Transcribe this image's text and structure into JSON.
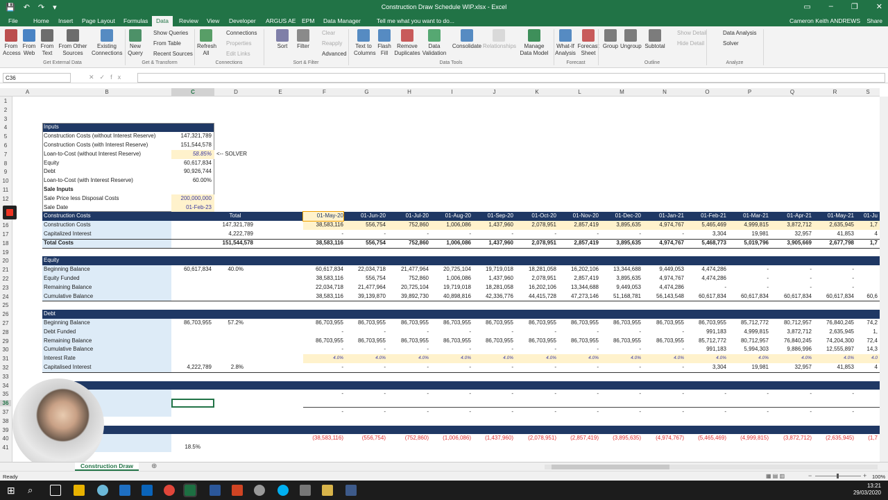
{
  "window": {
    "title": "Construction Draw Schedule WIP.xlsx - Excel",
    "user": "Cameron Keith ANDREWS",
    "share": "Share",
    "tell_me": "Tell me what you want to do..."
  },
  "tabs": [
    "File",
    "Home",
    "Insert",
    "Page Layout",
    "Formulas",
    "Data",
    "Review",
    "View",
    "Developer",
    "ARGUS AE",
    "EPM",
    "Data Manager"
  ],
  "ribbon": {
    "buttons": [
      "From Access",
      "From Web",
      "From Text",
      "From Other Sources",
      "Existing Connections",
      "New Query",
      "Refresh All",
      "Sort",
      "Filter",
      "Text to Columns",
      "Flash Fill",
      "Remove Duplicates",
      "Data Validation",
      "Consolidate",
      "Relationships",
      "Manage Data Model",
      "What-If Analysis",
      "Forecast Sheet",
      "Group",
      "Ungroup",
      "Subtotal"
    ],
    "small": [
      "Show Queries",
      "From Table",
      "Recent Sources",
      "Connections",
      "Properties",
      "Edit Links",
      "Clear",
      "Reapply",
      "Advanced",
      "Show Detail",
      "Hide Detail",
      "Data Analysis",
      "Solver"
    ],
    "groups": [
      "Get External Data",
      "Get & Transform",
      "Connections",
      "Sort & Filter",
      "Data Tools",
      "Forecast",
      "Outline",
      "Analyze"
    ]
  },
  "name_box": "C36",
  "columns": [
    "A",
    "B",
    "C",
    "D",
    "E",
    "F",
    "G",
    "H",
    "I",
    "J",
    "K",
    "L",
    "M",
    "N",
    "O",
    "P",
    "Q",
    "R",
    "S"
  ],
  "rows": [
    "1",
    "2",
    "3",
    "4",
    "5",
    "6",
    "7",
    "8",
    "9",
    "10",
    "11",
    "12",
    "",
    "15",
    "16",
    "17",
    "18",
    "19",
    "20",
    "21",
    "22",
    "23",
    "24",
    "25",
    "26",
    "27",
    "28",
    "29",
    "30",
    "31",
    "32",
    "33",
    "34",
    "35",
    "36",
    "37",
    "38",
    "39",
    "40",
    "41"
  ],
  "inputs": {
    "header": "Inputs",
    "rows": [
      {
        "label": "Construction Costs (without Interest Reserve)",
        "value": "147,321,789"
      },
      {
        "label": "Construction Costs (with Interest Reserve)",
        "value": "151,544,578"
      },
      {
        "label": "Loan-to-Cost (without Interest Reserve)",
        "value": "58.85%"
      },
      {
        "label": "Equity",
        "value": "60,617,834"
      },
      {
        "label": "Debt",
        "value": "90,926,744"
      },
      {
        "label": "Loan-to-Cost (with Interest Reserve)",
        "value": "60.00%"
      },
      {
        "label": "Sale Inputs",
        "value": ""
      },
      {
        "label": "Sale Price less Disposal Costs",
        "value": "200,000,000"
      },
      {
        "label": "Sale Date",
        "value": "01-Feb-23"
      }
    ],
    "solver_note": "<-- SOLVER"
  },
  "dates": [
    "01-May-20",
    "01-Jun-20",
    "01-Jul-20",
    "01-Aug-20",
    "01-Sep-20",
    "01-Oct-20",
    "01-Nov-20",
    "01-Dec-20",
    "01-Jan-21",
    "01-Feb-21",
    "01-Mar-21",
    "01-Apr-21",
    "01-May-21",
    "01-Ju"
  ],
  "costs": {
    "header": "Construction Costs",
    "total_label": "Total",
    "rows": [
      {
        "label": "Construction Costs",
        "total": "147,321,789",
        "vals": [
          "38,583,116",
          "556,754",
          "752,860",
          "1,006,086",
          "1,437,960",
          "2,078,951",
          "2,857,419",
          "3,895,635",
          "4,974,767",
          "5,465,469",
          "4,999,815",
          "3,872,712",
          "2,635,945",
          "1,7"
        ]
      },
      {
        "label": "Capitalized Interest",
        "total": "4,222,789",
        "vals": [
          "-",
          "-",
          "-",
          "-",
          "-",
          "-",
          "-",
          "-",
          "-",
          "3,304",
          "19,981",
          "32,957",
          "41,853",
          "4"
        ]
      },
      {
        "label": "Total Costs",
        "total": "151,544,578",
        "vals": [
          "38,583,116",
          "556,754",
          "752,860",
          "1,006,086",
          "1,437,960",
          "2,078,951",
          "2,857,419",
          "3,895,635",
          "4,974,767",
          "5,468,773",
          "5,019,796",
          "3,905,669",
          "2,677,798",
          "1,7"
        ]
      }
    ]
  },
  "equity": {
    "header": "Equity",
    "c": "60,617,834",
    "d": "40.0%",
    "rows": [
      {
        "label": "Beginning Balance",
        "vals": [
          "60,617,834",
          "22,034,718",
          "21,477,964",
          "20,725,104",
          "19,719,018",
          "18,281,058",
          "16,202,106",
          "13,344,688",
          "9,449,053",
          "4,474,286",
          "-",
          "-",
          "-",
          ""
        ]
      },
      {
        "label": "Equity Funded",
        "vals": [
          "38,583,116",
          "556,754",
          "752,860",
          "1,006,086",
          "1,437,960",
          "2,078,951",
          "2,857,419",
          "3,895,635",
          "4,974,767",
          "4,474,286",
          "-",
          "-",
          "-",
          ""
        ]
      },
      {
        "label": "Remaining Balance",
        "vals": [
          "22,034,718",
          "21,477,964",
          "20,725,104",
          "19,719,018",
          "18,281,058",
          "16,202,106",
          "13,344,688",
          "9,449,053",
          "4,474,286",
          "-",
          "-",
          "-",
          "-",
          ""
        ]
      },
      {
        "label": "Cumulative Balance",
        "vals": [
          "38,583,116",
          "39,139,870",
          "39,892,730",
          "40,898,816",
          "42,336,776",
          "44,415,728",
          "47,273,146",
          "51,168,781",
          "56,143,548",
          "60,617,834",
          "60,617,834",
          "60,617,834",
          "60,617,834",
          "60,6"
        ]
      }
    ]
  },
  "debt": {
    "header": "Debt",
    "c": "86,703,955",
    "d": "57.2%",
    "c32": "4,222,789",
    "d32": "2.8%",
    "rows": [
      {
        "label": "Beginning Balance",
        "vals": [
          "86,703,955",
          "86,703,955",
          "86,703,955",
          "86,703,955",
          "86,703,955",
          "86,703,955",
          "86,703,955",
          "86,703,955",
          "86,703,955",
          "86,703,955",
          "85,712,772",
          "80,712,957",
          "76,840,245",
          "74,2"
        ]
      },
      {
        "label": "Debt Funded",
        "vals": [
          "-",
          "-",
          "-",
          "-",
          "-",
          "-",
          "-",
          "-",
          "-",
          "991,183",
          "4,999,815",
          "3,872,712",
          "2,635,945",
          "1,"
        ]
      },
      {
        "label": "Remaining Balance",
        "vals": [
          "86,703,955",
          "86,703,955",
          "86,703,955",
          "86,703,955",
          "86,703,955",
          "86,703,955",
          "86,703,955",
          "86,703,955",
          "86,703,955",
          "85,712,772",
          "80,712,957",
          "76,840,245",
          "74,204,300",
          "72,4"
        ]
      },
      {
        "label": "Cumulative Balance",
        "vals": [
          "-",
          "-",
          "-",
          "-",
          "-",
          "-",
          "-",
          "-",
          "-",
          "991,183",
          "5,994,303",
          "9,886,996",
          "12,555,897",
          "14,3"
        ]
      },
      {
        "label": "Interest Rate",
        "vals": [
          "4.0%",
          "4.0%",
          "4.0%",
          "4.0%",
          "4.0%",
          "4.0%",
          "4.0%",
          "4.0%",
          "4.0%",
          "4.0%",
          "4.0%",
          "4.0%",
          "4.0%",
          "4.0"
        ]
      },
      {
        "label": "Capitalised Interest",
        "vals": [
          "-",
          "-",
          "-",
          "-",
          "-",
          "-",
          "-",
          "-",
          "-",
          "3,304",
          "19,981",
          "32,957",
          "41,853",
          "4"
        ]
      }
    ]
  },
  "row40": [
    "(38,583,116)",
    "(556,754)",
    "(752,860)",
    "(1,006,086)",
    "(1,437,960)",
    "(2,078,951)",
    "(2,857,419)",
    "(3,895,635)",
    "(4,974,767)",
    "(5,465,469)",
    "(4,999,815)",
    "(3,872,712)",
    "(2,635,945)",
    "(1,7"
  ],
  "row41_d": "18.5%",
  "sheet_tab": "Construction Draw",
  "status": {
    "ready": "Ready",
    "zoom": "100%"
  },
  "clock": {
    "time": "13:21",
    "date": "29/03/2020"
  },
  "colors": {
    "excel_green": "#217346",
    "header_navy": "#1f3864",
    "light_blue": "#ddebf7",
    "yellow": "#fff2cc",
    "neg_red": "#e03030",
    "italic_blue": "#3a3aa0"
  }
}
